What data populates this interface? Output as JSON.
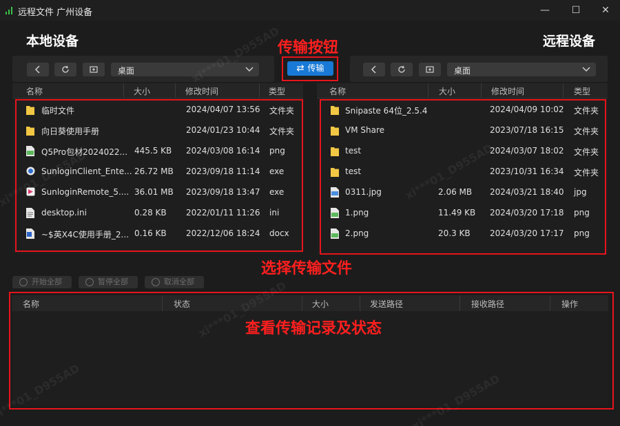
{
  "window": {
    "title": "远程文件 广州设备",
    "minimize_glyph": "—",
    "maximize_glyph": "☐",
    "close_glyph": "✕"
  },
  "local": {
    "title": "本地设备",
    "path": "桌面",
    "columns": [
      "名称",
      "大小",
      "修改时间",
      "类型"
    ],
    "files": [
      {
        "icon": "folder",
        "name": "临时文件",
        "size": "",
        "modified": "2024/04/07 13:56",
        "type": "文件夹"
      },
      {
        "icon": "folder",
        "name": "向日葵使用手册",
        "size": "",
        "modified": "2024/01/23 10:44",
        "type": "文件夹"
      },
      {
        "icon": "png",
        "name": "Q5Pro包材2024022...",
        "size": "445.5 KB",
        "modified": "2024/03/08 16:14",
        "type": "png"
      },
      {
        "icon": "exe-blue",
        "name": "SunloginClient_Ente...",
        "size": "26.72 MB",
        "modified": "2023/09/18 11:14",
        "type": "exe"
      },
      {
        "icon": "exe-pink",
        "name": "SunloginRemote_5....",
        "size": "36.01 MB",
        "modified": "2023/09/18 13:47",
        "type": "exe"
      },
      {
        "icon": "ini",
        "name": "desktop.ini",
        "size": "0.28 KB",
        "modified": "2022/01/11 11:26",
        "type": "ini"
      },
      {
        "icon": "docx",
        "name": "~$英X4C使用手册_2...",
        "size": "0.16 KB",
        "modified": "2022/12/06 18:24",
        "type": "docx"
      }
    ]
  },
  "remote": {
    "title": "远程设备",
    "path": "桌面",
    "columns": [
      "名称",
      "大小",
      "修改时间",
      "类型"
    ],
    "files": [
      {
        "icon": "folder",
        "name": "Snipaste 64位_2.5.4",
        "size": "",
        "modified": "2024/04/09 10:02",
        "type": "文件夹"
      },
      {
        "icon": "folder",
        "name": "VM Share",
        "size": "",
        "modified": "2023/07/18 16:15",
        "type": "文件夹"
      },
      {
        "icon": "folder",
        "name": "test",
        "size": "",
        "modified": "2024/03/07 18:02",
        "type": "文件夹"
      },
      {
        "icon": "folder",
        "name": "test",
        "size": "",
        "modified": "2023/10/31 16:34",
        "type": "文件夹"
      },
      {
        "icon": "jpg",
        "name": "0311.jpg",
        "size": "2.06 MB",
        "modified": "2024/03/21 18:40",
        "type": "jpg"
      },
      {
        "icon": "png",
        "name": "1.png",
        "size": "11.49 KB",
        "modified": "2024/03/20 17:18",
        "type": "png"
      },
      {
        "icon": "png",
        "name": "2.png",
        "size": "20.3 KB",
        "modified": "2024/03/20 17:17",
        "type": "png"
      }
    ]
  },
  "transfer_button": "传输",
  "queue": {
    "start_all": "开始全部",
    "pause_all": "暂停全部",
    "cancel_all": "取消全部",
    "columns": [
      "名称",
      "状态",
      "大小",
      "发送路径",
      "接收路径",
      "操作"
    ]
  },
  "annotations": {
    "transfer": "传输按钮",
    "select": "选择传输文件",
    "view": "查看传输记录及状态"
  },
  "watermark": "xi***01_D955AD",
  "colors": {
    "accent": "#1879d6",
    "annotation": "#e8141c",
    "folder": "#f2c744",
    "app_icon": "#3cc24a"
  }
}
